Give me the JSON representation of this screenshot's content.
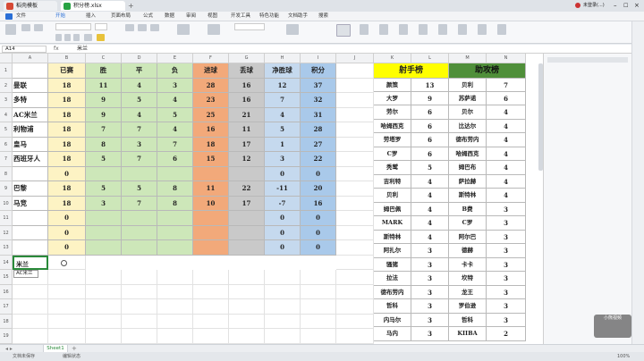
{
  "window": {
    "tabs": [
      {
        "label": "稻壳模板",
        "color": "#d64a36"
      },
      {
        "label": "积分榜.xlsx",
        "color": "#27a243"
      }
    ],
    "user": "未登录(...)"
  },
  "menu": [
    "文件",
    "开始",
    "插入",
    "页面布局",
    "公式",
    "数据",
    "审阅",
    "视图",
    "开发工具",
    "特色功能",
    "文档助手",
    "搜索"
  ],
  "formula_bar": {
    "cell_ref": "A14",
    "fx": "fx",
    "content": "米兰"
  },
  "columns": [
    "A",
    "B",
    "C",
    "D",
    "E",
    "F",
    "G",
    "H",
    "I",
    "J",
    "K",
    "L",
    "M",
    "N"
  ],
  "league_table": {
    "headers": [
      "",
      "已赛",
      "胜",
      "平",
      "负",
      "进球",
      "丢球",
      "净胜球",
      "积分"
    ],
    "rows": [
      [
        "曼联",
        "18",
        "11",
        "4",
        "3",
        "28",
        "16",
        "12",
        "37"
      ],
      [
        "多特",
        "18",
        "9",
        "5",
        "4",
        "23",
        "16",
        "7",
        "32"
      ],
      [
        "AC米兰",
        "18",
        "9",
        "4",
        "5",
        "25",
        "21",
        "4",
        "31"
      ],
      [
        "利物浦",
        "18",
        "7",
        "7",
        "4",
        "16",
        "11",
        "5",
        "28"
      ],
      [
        "皇马",
        "18",
        "8",
        "3",
        "7",
        "18",
        "17",
        "1",
        "27"
      ],
      [
        "西班牙人",
        "18",
        "5",
        "7",
        "6",
        "15",
        "12",
        "3",
        "22"
      ],
      [
        "",
        "0",
        "",
        "",
        "",
        "",
        "",
        "0",
        "0"
      ],
      [
        "巴黎",
        "18",
        "5",
        "5",
        "8",
        "11",
        "22",
        "-11",
        "20"
      ],
      [
        "马竞",
        "18",
        "3",
        "7",
        "8",
        "10",
        "17",
        "-7",
        "16"
      ],
      [
        "",
        "0",
        "",
        "",
        "",
        "",
        "",
        "0",
        "0"
      ],
      [
        "",
        "0",
        "",
        "",
        "",
        "",
        "",
        "0",
        "0"
      ],
      [
        "",
        "0",
        "",
        "",
        "",
        "",
        "",
        "0",
        "0"
      ]
    ],
    "row_numbers": [
      "1",
      "2",
      "3",
      "4",
      "5",
      "6",
      "7",
      "8",
      "9",
      "10",
      "11",
      "12",
      "13",
      "14",
      "15",
      "16",
      "17",
      "18",
      "19"
    ],
    "editing_cell": "米兰",
    "autocomplete": "AC米兰",
    "colors": {
      "played": "#fdf3c4",
      "wdl": "#cde7b9",
      "gf": "#f2a97a",
      "ga": "#c9c9c9",
      "gd": "#c5d9ee",
      "pts": "#a9c9ea"
    }
  },
  "scorers": {
    "title": "射手榜",
    "title_color": "#ffff00",
    "rows": [
      [
        "颜策",
        "13"
      ],
      [
        "大罗",
        "9"
      ],
      [
        "劳尔",
        "6"
      ],
      [
        "哈姆西克",
        "6"
      ],
      [
        "劳塔罗",
        "6"
      ],
      [
        "C罗",
        "6"
      ],
      [
        "秃鹫",
        "5"
      ],
      [
        "吉利特",
        "4"
      ],
      [
        "贝利",
        "4"
      ],
      [
        "姆巴佩",
        "4"
      ],
      [
        "MARK",
        "4"
      ],
      [
        "斯特林",
        "4"
      ],
      [
        "阿扎尔",
        "3"
      ],
      [
        "骚猪",
        "3"
      ],
      [
        "拉法",
        "3"
      ],
      [
        "德布劳内",
        "3"
      ],
      [
        "哲科",
        "3"
      ],
      [
        "内马尔",
        "3"
      ],
      [
        "马内",
        "3"
      ]
    ]
  },
  "assists": {
    "title": "助攻榜",
    "title_color": "#4f8f3a",
    "rows": [
      [
        "贝利",
        "7"
      ],
      [
        "苏萨诺",
        "6"
      ],
      [
        "贝尔",
        "4"
      ],
      [
        "比达尔",
        "4"
      ],
      [
        "德布劳内",
        "4"
      ],
      [
        "哈姆西克",
        "4"
      ],
      [
        "姆巴布",
        "4"
      ],
      [
        "萨拉赫",
        "4"
      ],
      [
        "斯特林",
        "4"
      ],
      [
        "B费",
        "3"
      ],
      [
        "C罗",
        "3"
      ],
      [
        "阿尔巴",
        "3"
      ],
      [
        "德赫",
        "3"
      ],
      [
        "卡卡",
        "3"
      ],
      [
        "坎特",
        "3"
      ],
      [
        "龙王",
        "3"
      ],
      [
        "罗伯逊",
        "3"
      ],
      [
        "哲科",
        "3"
      ],
      [
        "KIIBA",
        "2"
      ]
    ]
  },
  "sheet_tab": "Sheet1",
  "status": {
    "left": "文档未保存",
    "mode": "编辑状态",
    "zoom": "100%"
  },
  "watermark": "小熊视频"
}
